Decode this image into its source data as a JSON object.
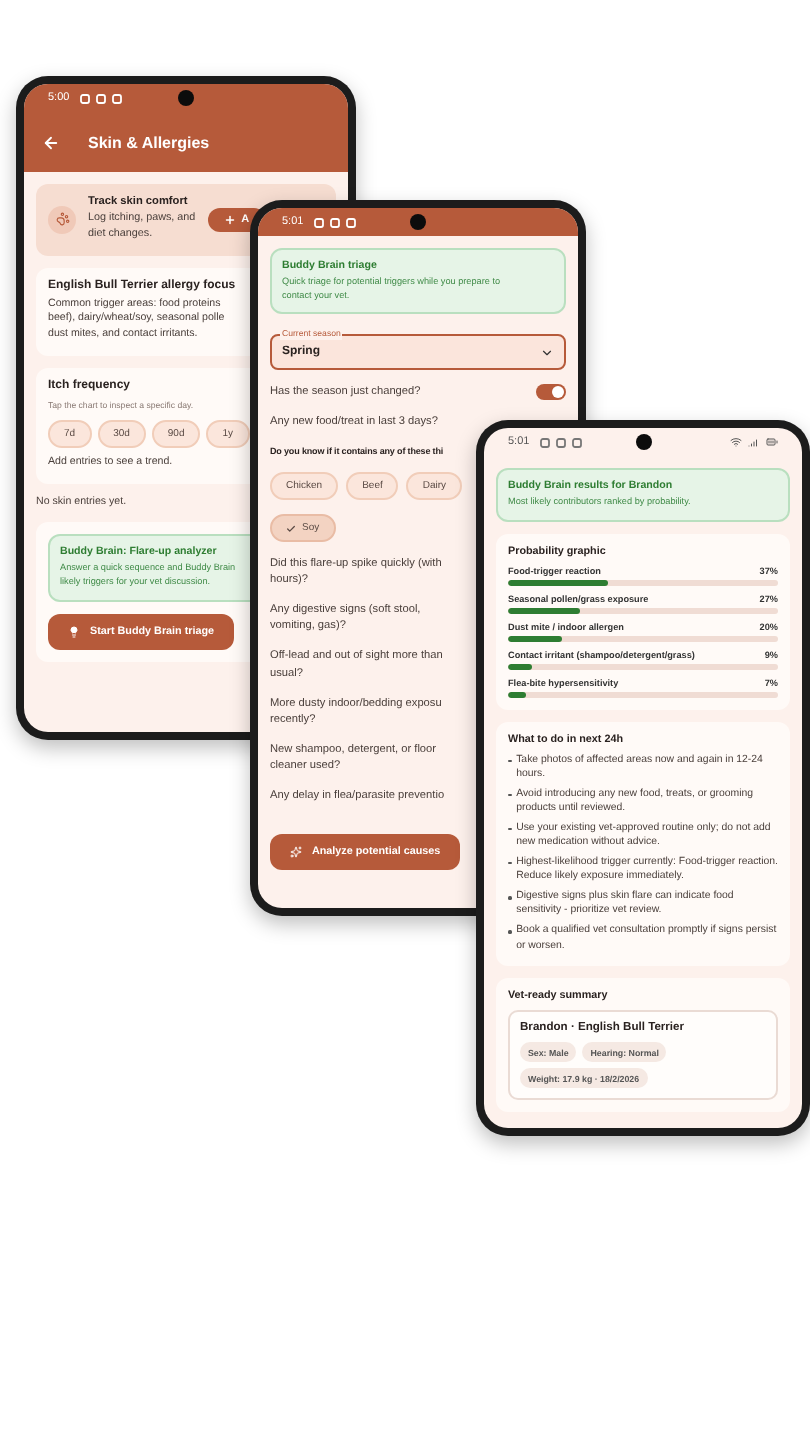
{
  "skin_screen": {
    "status_bar": {
      "time": "5:00"
    },
    "app_bar": {
      "title": "Skin & Allergies"
    },
    "track_card": {
      "title": "Track skin comfort",
      "lines": [
        "Log itching, paws, and",
        "diet changes."
      ],
      "button": "A"
    },
    "focus_card": {
      "title": "English Bull Terrier allergy focus",
      "lines": [
        "Common trigger areas: food proteins",
        "beef), dairy/wheat/soy, seasonal polle",
        "dust mites, and contact irritants."
      ]
    },
    "itch_card": {
      "title": "Itch frequency",
      "hint": "Tap the chart to inspect a specific day.",
      "ranges": [
        "7d",
        "30d",
        "90d",
        "1y"
      ],
      "empty_text": "Add entries to see a trend."
    },
    "empty_text": "No skin entries yet.",
    "analyzer_card": {
      "title": "Buddy Brain: Flare-up analyzer",
      "lines": [
        "Answer a quick sequence and Buddy Brain",
        "likely triggers for your vet discussion."
      ]
    },
    "start_button": "Start Buddy Brain triage"
  },
  "triage_screen": {
    "status_bar": {
      "time": "5:01"
    },
    "intro_card": {
      "title": "Buddy Brain triage",
      "lines": [
        "Quick triage for potential triggers while you prepare to",
        "contact your vet."
      ]
    },
    "season_field": {
      "label": "Current season",
      "value": "Spring"
    },
    "questions": [
      {
        "kind": "toggle",
        "text": "Has the season just changed?",
        "on": true
      },
      {
        "kind": "text",
        "text": "Any new food/treat in last 3 days?"
      }
    ],
    "ingredients": {
      "prompt": "Do you know if it contains any of these thi",
      "chips": [
        {
          "label": "Chicken",
          "selected": false
        },
        {
          "label": "Beef",
          "selected": false
        },
        {
          "label": "Dairy",
          "selected": false
        },
        {
          "label": "Soy",
          "selected": true
        }
      ]
    },
    "more_questions": [
      {
        "lines": [
          "Did this flare-up spike quickly (with",
          "hours)?"
        ]
      },
      {
        "lines": [
          "Any digestive signs (soft stool,",
          "vomiting, gas)?"
        ]
      },
      {
        "lines": [
          "Off-lead and out of sight more than",
          "usual?"
        ]
      },
      {
        "lines": [
          "More dusty indoor/bedding exposu",
          "recently?"
        ]
      },
      {
        "lines": [
          "New shampoo, detergent, or floor",
          "cleaner used?"
        ]
      },
      {
        "lines": [
          "Any delay in flea/parasite preventio"
        ]
      }
    ],
    "analyze_button": "Analyze potential causes"
  },
  "results_screen": {
    "status_bar": {
      "time": "5:01"
    },
    "results_card": {
      "title": "Buddy Brain results for Brandon",
      "text": "Most likely contributors ranked by probability."
    },
    "probability": {
      "title": "Probability graphic",
      "items": [
        {
          "label": "Food-trigger reaction",
          "value": "37%",
          "level": 0.37
        },
        {
          "label": "Seasonal pollen/grass exposure",
          "value": "27%",
          "level": 0.27
        },
        {
          "label": "Dust mite / indoor allergen",
          "value": "20%",
          "level": 0.2
        },
        {
          "label": "Contact irritant (shampoo/detergent/grass)",
          "value": "9%",
          "level": 0.09
        },
        {
          "label": "Flea-bite hypersensitivity",
          "value": "7%",
          "level": 0.07
        }
      ]
    },
    "next_steps": {
      "title": "What to do in next 24h",
      "items": [
        "Take photos of affected areas now and again in 12-24 hours.",
        "Avoid introducing any new food, treats, or grooming products until reviewed.",
        "Use your existing vet-approved routine only; do not add new medication without advice.",
        "Highest-likelihood trigger currently: Food-trigger reaction. Reduce likely exposure immediately.",
        "Digestive signs plus skin flare can indicate food sensitivity - prioritize vet review.",
        "Book a qualified vet consultation promptly if signs persist or worsen."
      ]
    },
    "summary": {
      "title": "Vet-ready summary",
      "pet": "Brandon · English Bull Terrier",
      "tags": [
        "Sex: Male",
        "Hearing: Normal",
        "Weight: 17.9 kg · 18/2/2026"
      ]
    }
  }
}
